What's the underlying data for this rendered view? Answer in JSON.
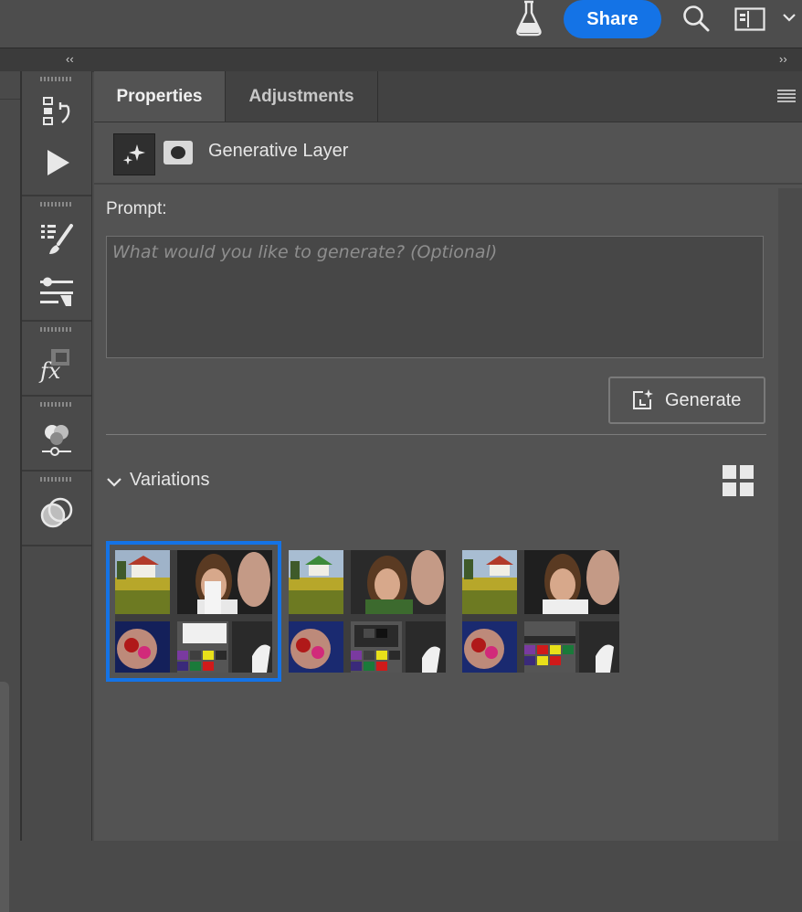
{
  "topbar": {
    "labs_icon": "flask-icon",
    "share_label": "Share",
    "search_icon": "search-icon",
    "workspace_icon": "workspace-layout-icon",
    "dropdown_icon": "chevron-down-icon"
  },
  "collapse": {
    "left": "‹‹",
    "right": "››"
  },
  "toolbar": {
    "tools": [
      "history-icon",
      "play-action-icon",
      "brush-presets-icon",
      "adjust-sliders-icon",
      "fx-styles-icon",
      "adjustments-icon",
      "channels-icon"
    ]
  },
  "panel": {
    "tabs": [
      {
        "label": "Properties",
        "active": true
      },
      {
        "label": "Adjustments",
        "active": false
      }
    ],
    "menu_icon": "panel-menu-icon",
    "layer": {
      "name": "Generative Layer",
      "thumb_icon": "sparkle-icon",
      "mask_icon": "mask-icon"
    },
    "prompt": {
      "label": "Prompt:",
      "value": "",
      "placeholder": "What would you like to generate? (Optional)"
    },
    "generate_label": "Generate",
    "variations": {
      "label": "Variations",
      "grid_icon": "grid-view-icon",
      "items": [
        {
          "selected": true,
          "variant": "a"
        },
        {
          "selected": false,
          "variant": "b"
        },
        {
          "selected": false,
          "variant": "c"
        }
      ]
    }
  },
  "colors": {
    "accent": "#1473e6",
    "panel_bg": "#535353",
    "tab_bar": "#424242"
  }
}
